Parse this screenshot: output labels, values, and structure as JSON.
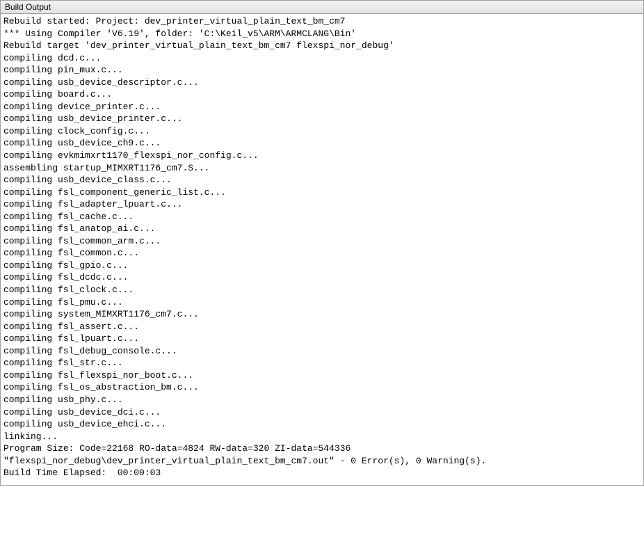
{
  "panel": {
    "title": "Build Output"
  },
  "log": {
    "lines": [
      "Rebuild started: Project: dev_printer_virtual_plain_text_bm_cm7",
      "*** Using Compiler 'V6.19', folder: 'C:\\Keil_v5\\ARM\\ARMCLANG\\Bin'",
      "Rebuild target 'dev_printer_virtual_plain_text_bm_cm7 flexspi_nor_debug'",
      "compiling dcd.c...",
      "compiling pin_mux.c...",
      "compiling usb_device_descriptor.c...",
      "compiling board.c...",
      "compiling device_printer.c...",
      "compiling usb_device_printer.c...",
      "compiling clock_config.c...",
      "compiling usb_device_ch9.c...",
      "compiling evkmimxrt1170_flexspi_nor_config.c...",
      "assembling startup_MIMXRT1176_cm7.S...",
      "compiling usb_device_class.c...",
      "compiling fsl_component_generic_list.c...",
      "compiling fsl_adapter_lpuart.c...",
      "compiling fsl_cache.c...",
      "compiling fsl_anatop_ai.c...",
      "compiling fsl_common_arm.c...",
      "compiling fsl_common.c...",
      "compiling fsl_gpio.c...",
      "compiling fsl_dcdc.c...",
      "compiling fsl_clock.c...",
      "compiling fsl_pmu.c...",
      "compiling system_MIMXRT1176_cm7.c...",
      "compiling fsl_assert.c...",
      "compiling fsl_lpuart.c...",
      "compiling fsl_debug_console.c...",
      "compiling fsl_str.c...",
      "compiling fsl_flexspi_nor_boot.c...",
      "compiling fsl_os_abstraction_bm.c...",
      "compiling usb_phy.c...",
      "compiling usb_device_dci.c...",
      "compiling usb_device_ehci.c...",
      "linking...",
      "Program Size: Code=22168 RO-data=4824 RW-data=320 ZI-data=544336",
      "\"flexspi_nor_debug\\dev_printer_virtual_plain_text_bm_cm7.out\" - 0 Error(s), 0 Warning(s).",
      "Build Time Elapsed:  00:00:03"
    ]
  }
}
